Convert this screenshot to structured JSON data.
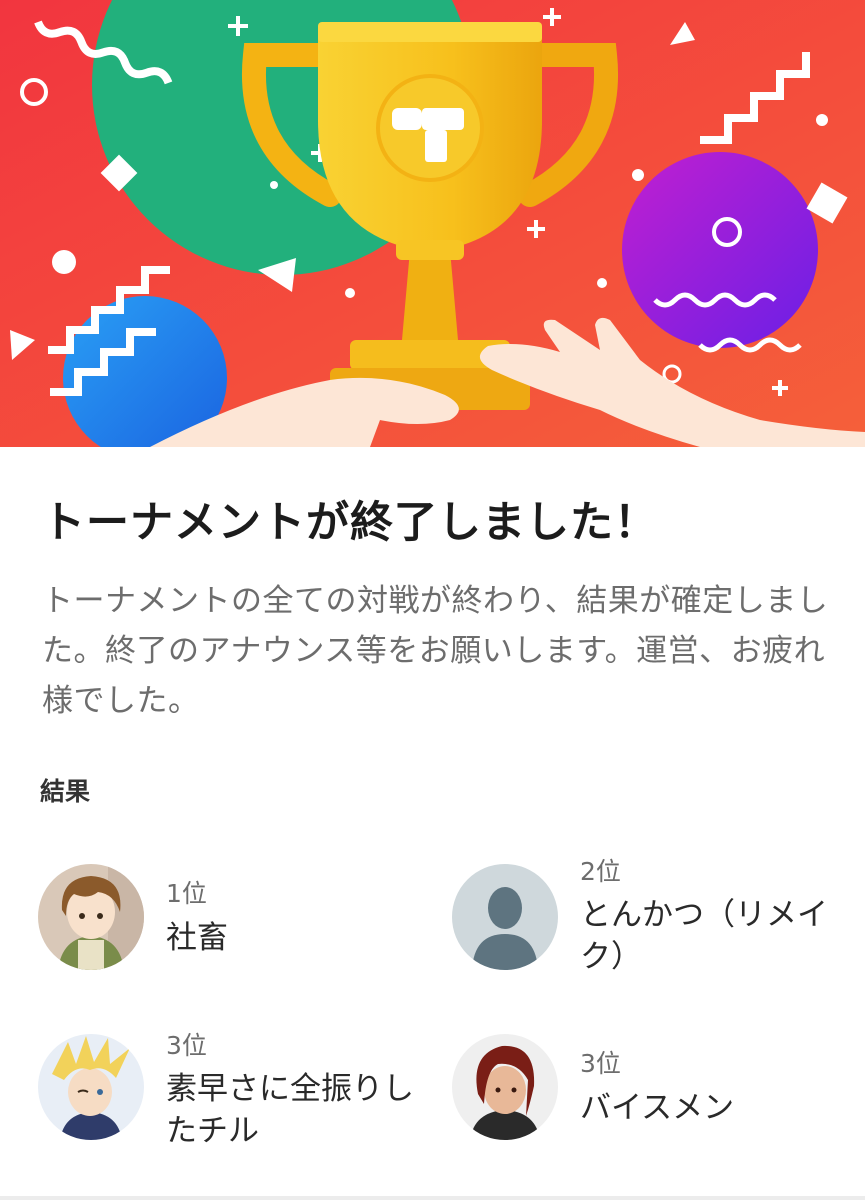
{
  "banner": {
    "logo_glyph": "T",
    "colors": {
      "background": "#f24438",
      "trophy": "#f6c21a",
      "green_circle": "#25b07a",
      "purple_circle": "#a21fd6",
      "blue_circle": "#1e84f0"
    }
  },
  "header": {
    "title": "トーナメントが終了しました！"
  },
  "description": {
    "text": "トーナメントの全ての対戦が終わり、結果が確定しました。終了のアナウンス等をお願いします。運営、お疲れ様でした。"
  },
  "results": {
    "label": "結果",
    "entries": [
      {
        "rank": "1位",
        "name": "社畜",
        "avatar": "anime-girl-avatar"
      },
      {
        "rank": "2位",
        "name": "とんかつ（リメイク）",
        "avatar": "default-user-avatar"
      },
      {
        "rank": "3位",
        "name": "素早さに全振りしたチル",
        "avatar": "blond-character-avatar"
      },
      {
        "rank": "3位",
        "name": "バイスメン",
        "avatar": "red-hair-character-avatar"
      }
    ]
  }
}
